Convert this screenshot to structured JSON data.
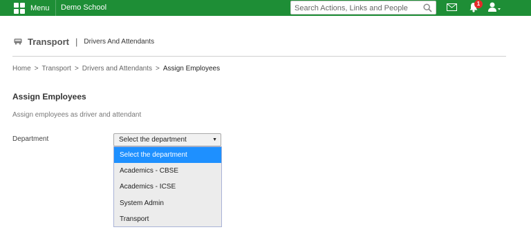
{
  "topbar": {
    "menu_label": "Menu",
    "school_name": "Demo School",
    "search_placeholder": "Search Actions, Links and People",
    "notification_count": "1",
    "bar_color": "#1e8e36"
  },
  "page": {
    "title": "Transport",
    "separator": "|",
    "subtitle": "Drivers And Attendants"
  },
  "breadcrumb": {
    "items": [
      "Home",
      "Transport",
      "Drivers and Attendants"
    ],
    "current": "Assign Employees",
    "separator": ">"
  },
  "section": {
    "title": "Assign Employees",
    "description": "Assign employees as driver and attendant"
  },
  "form": {
    "department_label": "Department",
    "department_selected": "Select the department",
    "options": [
      "Select the department",
      "Academics - CBSE",
      "Academics - ICSE",
      "System Admin",
      "Transport"
    ],
    "highlight_color": "#1e90ff"
  }
}
